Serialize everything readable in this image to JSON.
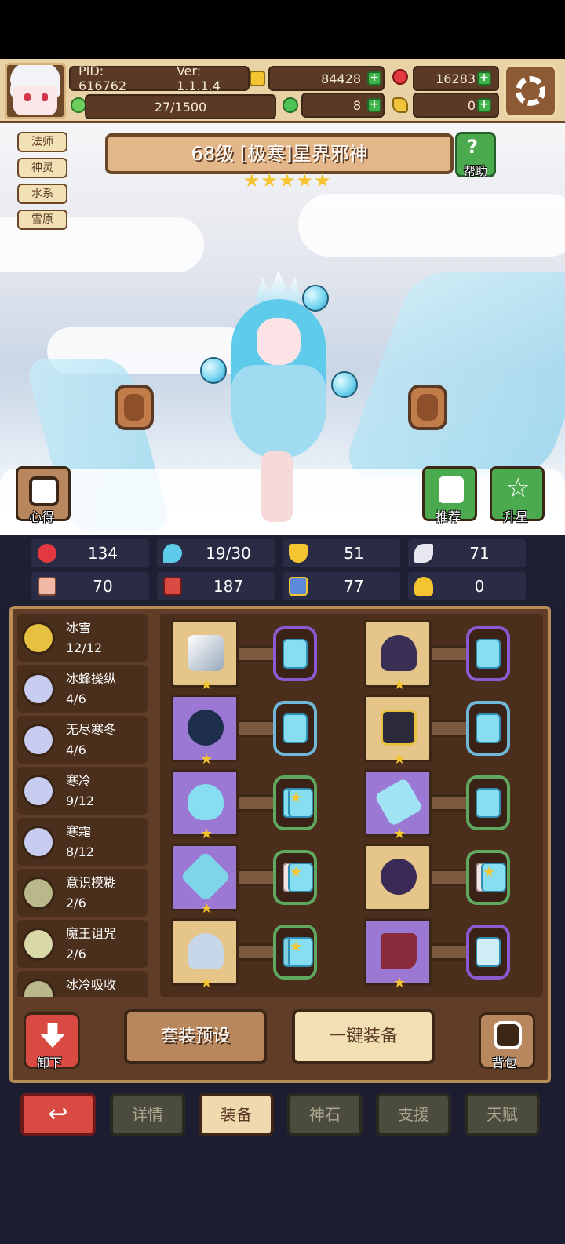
{
  "hud": {
    "pid": "PID: 616762",
    "version": "Ver: 1.1.1.4",
    "gold": "84428",
    "gems": "16283",
    "stamina": "27/1500",
    "clover": "8",
    "key": "0"
  },
  "tags": [
    "法师",
    "神灵",
    "水系",
    "雪原"
  ],
  "hero": {
    "title": "68级  [极寒]星界邪神",
    "stars": 5
  },
  "buttons": {
    "help": "帮助",
    "insight": "心得",
    "recommend": "推荐",
    "star_up": "升星",
    "unequip": "卸下",
    "preset": "套装预设",
    "equip_all": "一键装备",
    "bag": "背包"
  },
  "stats": [
    "134",
    "19/30",
    "51",
    "71",
    "70",
    "187",
    "77",
    "0"
  ],
  "sets": [
    {
      "name": "冰雪",
      "count": "12/12"
    },
    {
      "name": "冰蜂操纵",
      "count": "4/6"
    },
    {
      "name": "无尽寒冬",
      "count": "4/6"
    },
    {
      "name": "寒冷",
      "count": "9/12"
    },
    {
      "name": "寒霜",
      "count": "8/12"
    },
    {
      "name": "意识模糊",
      "count": "2/6"
    },
    {
      "name": "魔王诅咒",
      "count": "2/6"
    },
    {
      "name": "冰冷吸收",
      "count": ""
    }
  ],
  "tabs": [
    "详情",
    "装备",
    "神石",
    "支援",
    "天赋"
  ],
  "colors": {
    "panel": "#5f3d26",
    "gold_frame": "#e6c58a",
    "purple_frame": "#9a78d4",
    "accent_green": "#3fb24a",
    "back_red": "#d94a42"
  }
}
